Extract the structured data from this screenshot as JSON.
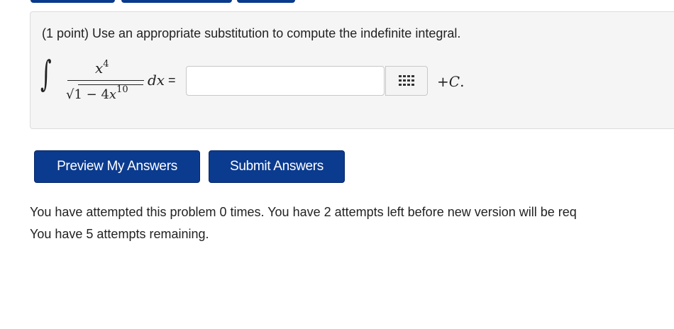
{
  "problem": {
    "prompt": "(1 point) Use an appropriate substitution to compute the indefinite integral.",
    "integral_sign": "∫",
    "numerator_var": "x",
    "numerator_exp": "4",
    "denominator_prefix": "√1 − 4",
    "denominator_var": "x",
    "denominator_exp": "10",
    "differential": "dx",
    "equals": "=",
    "answer_value": "",
    "plus": "+",
    "constant": "C",
    "period": "."
  },
  "buttons": {
    "preview": "Preview My Answers",
    "submit": "Submit Answers"
  },
  "status": {
    "attempts_line1": "You have attempted this problem 0 times. You have 2 attempts left before new version will be req",
    "attempts_line2": "You have 5 attempts remaining."
  },
  "icons": {
    "keypad": "keypad-grid-icon"
  },
  "colors": {
    "button_bg": "#0b3b8f",
    "button_text": "#ffffff",
    "panel_bg": "#f5f5f5"
  }
}
